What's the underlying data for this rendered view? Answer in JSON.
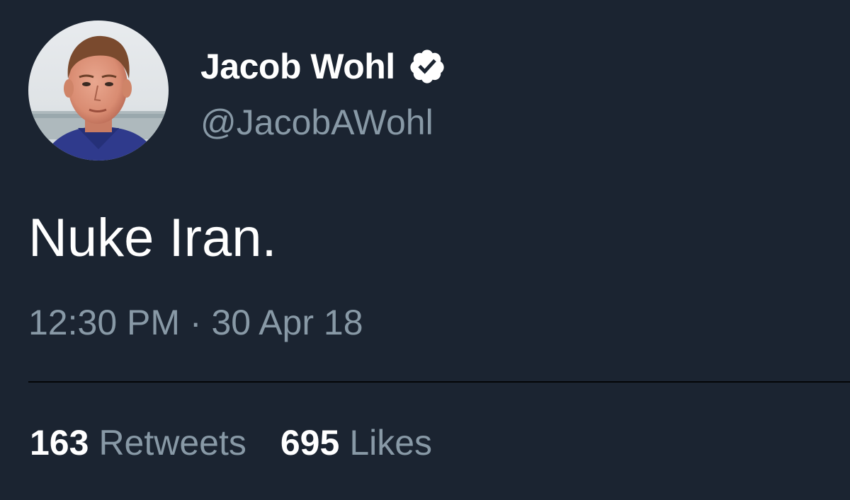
{
  "tweet": {
    "display_name": "Jacob Wohl",
    "handle": "@JacobAWohl",
    "verified": true,
    "text": "Nuke Iran.",
    "time": "12:30 PM",
    "separator": "·",
    "date": "30 Apr 18",
    "timestamp": "12:30 PM · 30 Apr 18"
  },
  "stats": {
    "retweets_count": "163",
    "retweets_label": "Retweets",
    "likes_count": "695",
    "likes_label": "Likes"
  },
  "colors": {
    "background": "#1b2431",
    "primary_text": "#ffffff",
    "secondary_text": "#8899a6"
  },
  "icons": {
    "verified": "verified-badge-icon"
  }
}
